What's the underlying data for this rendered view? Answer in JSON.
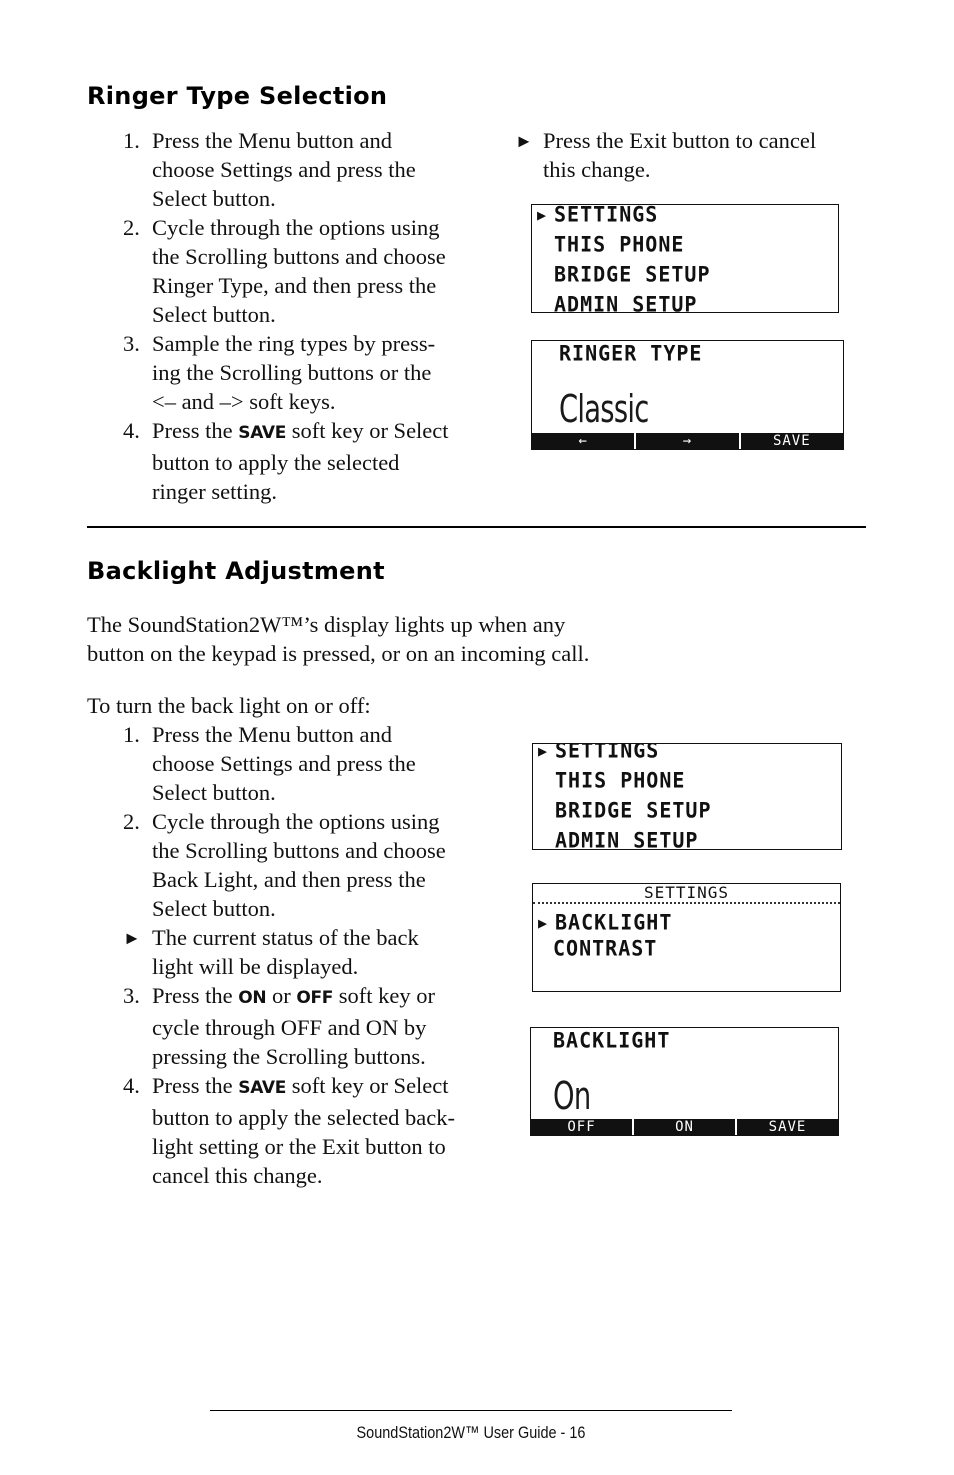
{
  "section1": {
    "heading": "Ringer Type Selection",
    "steps": [
      {
        "num": "1.",
        "lines": [
          "Press the Menu button and",
          "choose Settings and press the",
          "Select button."
        ]
      },
      {
        "num": "2.",
        "lines": [
          "Cycle through the options using",
          "the Scrolling buttons and choose",
          "Ringer Type, and then press the",
          "Select button."
        ]
      },
      {
        "num": "3.",
        "lines": [
          "Sample the ring types by press-",
          "ing the Scrolling buttons or the",
          "<– and –> soft keys."
        ]
      },
      {
        "num": "4.",
        "pre": "Press the ",
        "key": "SAVE",
        "post": " soft key or Select",
        "lines": [
          "button to apply the selected",
          "ringer setting."
        ]
      }
    ],
    "note": {
      "arrow": "►",
      "lines": [
        "Press the Exit button to cancel",
        "this change."
      ]
    },
    "screen_menu": {
      "selector": "▶",
      "items": [
        "SETTINGS",
        "THIS PHONE",
        "BRIDGE SETUP",
        "ADMIN SETUP"
      ]
    },
    "screen_ringer": {
      "title": "RINGER TYPE",
      "value": "Classic",
      "softkeys": [
        "←",
        "→",
        "SAVE"
      ]
    }
  },
  "section2": {
    "heading": "Backlight Adjustment",
    "intro": [
      "The SoundStation2W™’s display lights up when any",
      "button on the keypad is pressed, or on an incoming call."
    ],
    "lead": "To turn the back light on or off:",
    "steps": [
      {
        "num": "1.",
        "lines": [
          "Press the Menu button and",
          "choose Settings and press the",
          "Select button."
        ]
      },
      {
        "num": "2.",
        "lines": [
          "Cycle through the options using",
          "the Scrolling buttons and choose",
          "Back Light, and then press the",
          "Select button."
        ]
      },
      {
        "arrow": "►",
        "lines": [
          "The current status of the back",
          "light will be displayed."
        ]
      },
      {
        "num": "3.",
        "pre": "Press the ",
        "key": "ON",
        "mid": " or ",
        "key2": "OFF",
        "post": " soft key or",
        "lines": [
          "cycle through OFF and ON by",
          "pressing the Scrolling buttons."
        ]
      },
      {
        "num": "4.",
        "pre": "Press the ",
        "key": "SAVE",
        "post": " soft key or Select",
        "lines": [
          "button to apply the selected back-",
          "light setting or the Exit button to",
          "cancel this change."
        ]
      }
    ],
    "screen_menu": {
      "selector": "▶",
      "items": [
        "SETTINGS",
        "THIS PHONE",
        "BRIDGE SETUP",
        "ADMIN SETUP"
      ]
    },
    "screen_settings": {
      "title": "SETTINGS",
      "selector": "▶",
      "items": [
        "BACKLIGHT",
        "CONTRAST"
      ]
    },
    "screen_backlight": {
      "title": "BACKLIGHT",
      "value": "On",
      "softkeys": [
        "OFF",
        "ON",
        "SAVE"
      ]
    }
  },
  "footer": {
    "text": "SoundStation2W™ User Guide - 16"
  }
}
